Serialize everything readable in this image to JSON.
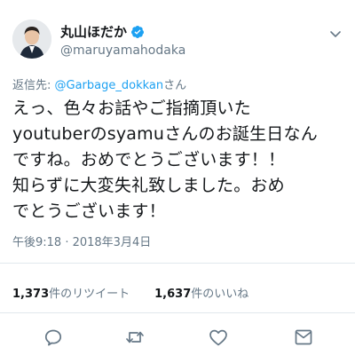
{
  "user": {
    "display_name": "丸山ほだか",
    "handle": "@maruyamahodaka",
    "verified": true
  },
  "reply": {
    "prefix": "返信先: ",
    "mention": "@Garbage_dokkan",
    "suffix": "さん"
  },
  "tweet": {
    "lines": [
      "えっ、色々お話やご指摘頂いた",
      "youtuberのsyamuさんのお誕生日なん",
      "ですね。おめでとうございます！！",
      "知らずに大変失礼致しました。おめ",
      "でとうございます！"
    ]
  },
  "timestamp": "午後9:18 · 2018年3月4日",
  "stats": {
    "retweets_count": "1,373",
    "retweets_label": "件のリツイート",
    "likes_count": "1,637",
    "likes_label": "件のいいね"
  },
  "icons": {
    "menu": "chevron-down-icon",
    "reply": "reply-icon",
    "retweet": "retweet-icon",
    "like": "heart-icon",
    "share": "share-icon"
  },
  "colors": {
    "accent": "#1da1f2",
    "muted": "#657786",
    "text": "#14171a",
    "divider": "#e1e8ed"
  }
}
